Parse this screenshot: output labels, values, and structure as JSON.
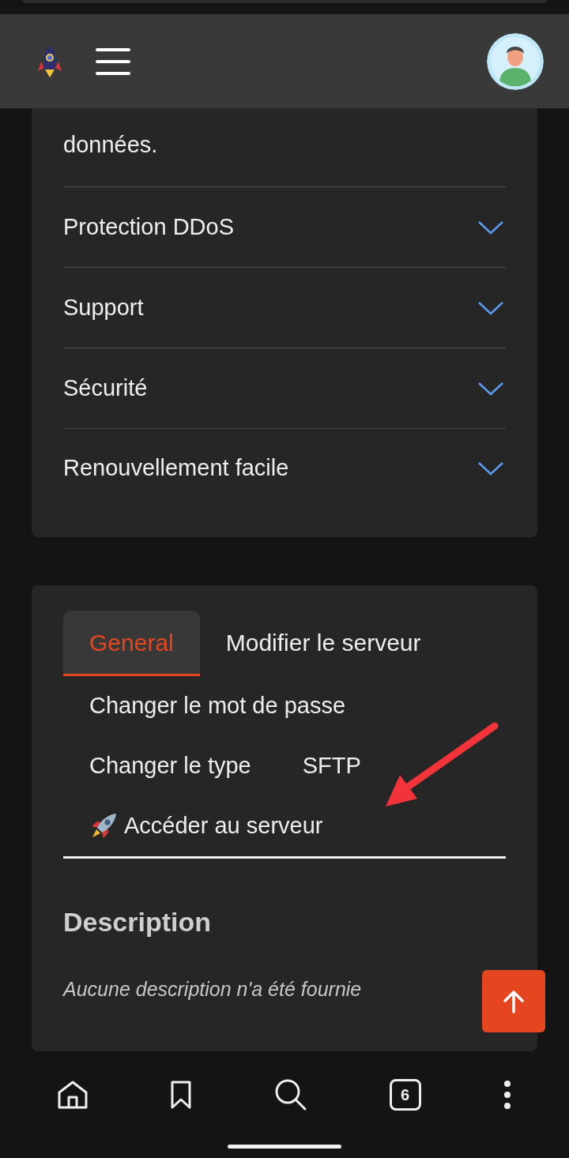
{
  "intro": {
    "text": "données."
  },
  "features": [
    {
      "label": "Protection DDoS",
      "expanded": false
    },
    {
      "label": "Support",
      "expanded": false
    },
    {
      "label": "Sécurité",
      "expanded": false
    },
    {
      "label": "Renouvellement facile",
      "expanded": false
    }
  ],
  "tabs": [
    {
      "label": "General",
      "selected": true
    },
    {
      "label": "Modifier le serveur",
      "selected": false
    }
  ],
  "actions": [
    {
      "label": "Changer le mot de passe",
      "kind": "link"
    },
    {
      "label": "Changer le type",
      "kind": "link"
    },
    {
      "label": "SFTP",
      "kind": "link"
    },
    {
      "label": "Accéder au serveur",
      "kind": "rocket-link"
    }
  ],
  "description": {
    "title": "Description",
    "text": "Aucune description n'a été fournie"
  },
  "browser_bar": {
    "tab_count": "6"
  }
}
